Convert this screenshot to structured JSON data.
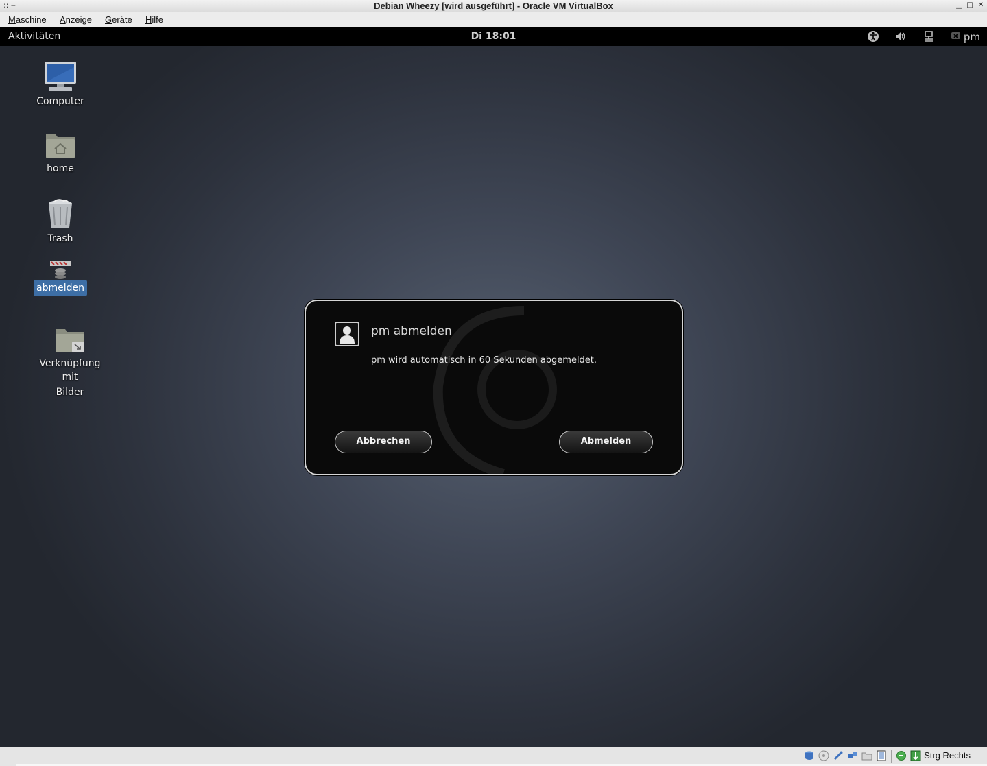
{
  "window": {
    "title": "Debian Wheezy [wird ausgeführt] - Oracle VM VirtualBox",
    "left_glyphs": ":: ‒",
    "min": "▁",
    "max": "□",
    "close": "✕"
  },
  "menubar": {
    "items": [
      {
        "underline": "M",
        "rest": "aschine"
      },
      {
        "underline": "A",
        "rest": "nzeige"
      },
      {
        "underline": "G",
        "rest": "eräte"
      },
      {
        "underline": "H",
        "rest": "ilfe"
      }
    ]
  },
  "panel": {
    "activities": "Aktivitäten",
    "clock": "Di 18:01",
    "user": "pm",
    "tray_icons": [
      "accessibility-icon",
      "volume-icon",
      "network-icon",
      "user-status-icon"
    ]
  },
  "desktop": {
    "icons": [
      {
        "label": "Computer",
        "icon": "computer-icon"
      },
      {
        "label": "home",
        "icon": "home-folder-icon"
      },
      {
        "label": "Trash",
        "icon": "trash-icon"
      },
      {
        "label": "abmelden",
        "icon": "logout-launcher-icon",
        "selected": true
      },
      {
        "label": "Verknüpfung mit",
        "label2": "Bilder",
        "icon": "folder-link-icon"
      }
    ]
  },
  "dialog": {
    "title": "pm abmelden",
    "message": "pm wird automatisch in 60 Sekunden abgemeldet.",
    "cancel_label": "Abbrechen",
    "confirm_label": "Abmelden"
  },
  "statusbar": {
    "host_key": "Strg Rechts",
    "icons": [
      "hard-disk-icon",
      "optical-drive-icon",
      "usb-icon",
      "network-adapter-icon",
      "shared-folders-icon",
      "display-icon",
      "video-capture-icon",
      "mouse-integration-icon"
    ]
  },
  "colors": {
    "panel_bg": "#000000",
    "dialog_bg": "#0a0a0a",
    "selection": "#3d6ea5",
    "desktop_center": "#566070"
  }
}
